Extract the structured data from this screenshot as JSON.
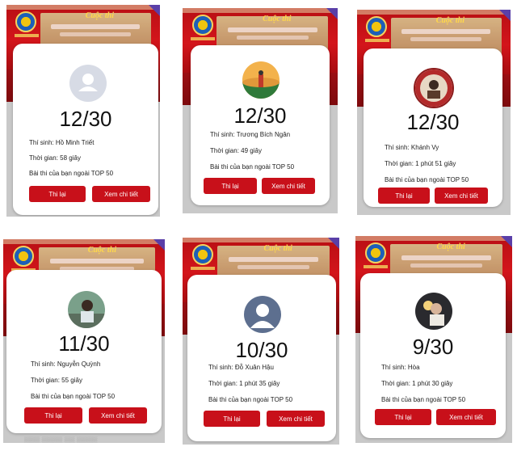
{
  "banner": {
    "script_text": "Cuộc thi"
  },
  "cards": [
    {
      "score": "12/30",
      "contestant": "Thí sinh: Hồ Minh Triết",
      "time": "Thời gian: 58 giây",
      "rank": "Bài thi của bạn ngoài TOP 50",
      "retry": "Thi lại",
      "details": "Xem chi tiết"
    },
    {
      "score": "12/30",
      "contestant": "Thí sinh: Trương Bích Ngân",
      "time": "Thời gian: 49 giây",
      "rank": "Bài thi của bạn ngoài TOP 50",
      "retry": "Thi lại",
      "details": "Xem chi tiết"
    },
    {
      "score": "12/30",
      "contestant": "Thí sinh: Khánh Vy",
      "time": "Thời gian: 1 phút 51 giây",
      "rank": "Bài thi của bạn ngoài TOP 50",
      "retry": "Thi lại",
      "details": "Xem chi tiết"
    },
    {
      "score": "11/30",
      "contestant": "Thí sinh: Nguyễn Quỳnh",
      "time": "Thời gian: 55 giây",
      "rank": "Bài thi của bạn ngoài TOP 50",
      "retry": "Thi lại",
      "details": "Xem chi tiết"
    },
    {
      "score": "10/30",
      "contestant": "Thí sinh: Đỗ Xuân Hậu",
      "time": "Thời gian: 1 phút 35 giây",
      "rank": "Bài thi của bạn ngoài TOP 50",
      "retry": "Thi lại",
      "details": "Xem chi tiết"
    },
    {
      "score": "9/30",
      "contestant": "Thí sinh: Hòa",
      "time": "Thời gian: 1 phút 30 giây",
      "rank": "Bài thi của bạn ngoài TOP 50",
      "retry": "Thi lại",
      "details": "Xem chi tiết"
    }
  ],
  "colors": {
    "accent_red": "#c8101a",
    "banner_red": "#d3151b"
  }
}
